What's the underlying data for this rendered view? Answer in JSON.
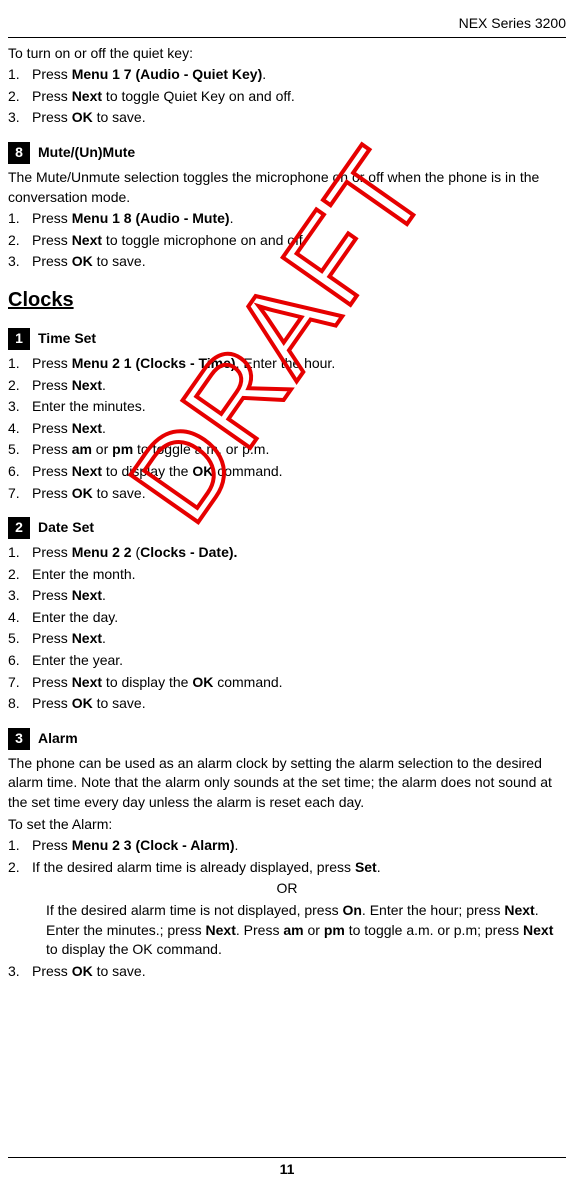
{
  "header": "NEX Series 3200",
  "intro": "To turn on or off the quiet key:",
  "quietKeyList": [
    {
      "n": "1.",
      "pre": "Press ",
      "b": "Menu 1 7 (Audio - Quiet Key)",
      "post": "."
    },
    {
      "n": "2.",
      "pre": "Press ",
      "b": "Next",
      "post": " to toggle Quiet Key on and off."
    },
    {
      "n": "3.",
      "pre": "Press ",
      "b": "OK",
      "post": " to save."
    }
  ],
  "sec8": {
    "num": "8",
    "title": "Mute/(Un)Mute"
  },
  "sec8Intro": "The Mute/Unmute selection toggles the microphone on or off when the phone is in the conversation mode.",
  "sec8List": [
    {
      "n": "1.",
      "pre": "Press ",
      "b": "Menu 1 8 (Audio - Mute)",
      "post": "."
    },
    {
      "n": "2.",
      "pre": "Press ",
      "b": "Next",
      "post": " to toggle microphone on and off."
    },
    {
      "n": "3.",
      "pre": "Press ",
      "b": "OK",
      "post": " to save."
    }
  ],
  "clocksTitle": "Clocks",
  "sec1": {
    "num": "1",
    "title": "Time Set"
  },
  "sec1List": [
    {
      "n": "1.",
      "pre": "Press ",
      "b": "Menu 2 1 (Clocks - Time)",
      "post": ". Enter the hour."
    },
    {
      "n": "2.",
      "pre": "Press ",
      "b": "Next",
      "post": "."
    },
    {
      "n": "3.",
      "pre": "Enter the minutes.",
      "b": "",
      "post": ""
    },
    {
      "n": "4.",
      "pre": "Press ",
      "b": "Next",
      "post": "."
    },
    {
      "n": "5.",
      "html": "Press <b>am</b> or <b>pm</b> to toggle a.m. or p.m."
    },
    {
      "n": "6.",
      "html": "Press <b>Next</b> to display the <b>OK</b> command."
    },
    {
      "n": "7.",
      "pre": "Press ",
      "b": "OK",
      "post": " to save."
    }
  ],
  "sec2": {
    "num": "2",
    "title": "Date Set"
  },
  "sec2List": [
    {
      "n": "1.",
      "html": "Press <b>Menu 2 2</b> (<b>Clocks - Date).</b>"
    },
    {
      "n": "2.",
      "pre": "Enter the month.",
      "b": "",
      "post": ""
    },
    {
      "n": "3.",
      "pre": "Press ",
      "b": "Next",
      "post": "."
    },
    {
      "n": "4.",
      "pre": "Enter the day.",
      "b": "",
      "post": ""
    },
    {
      "n": "5.",
      "pre": "Press ",
      "b": "Next",
      "post": "."
    },
    {
      "n": "6.",
      "pre": "Enter the year.",
      "b": "",
      "post": ""
    },
    {
      "n": "7.",
      "html": "Press <b>Next</b> to display the <b>OK</b> command."
    },
    {
      "n": "8.",
      "pre": "Press ",
      "b": "OK",
      "post": " to save."
    }
  ],
  "sec3": {
    "num": "3",
    "title": "Alarm"
  },
  "sec3Intro": "The phone can be used as an alarm clock by setting the alarm selection to the desired alarm time. Note that the alarm only sounds at the set time; the alarm does not sound at the set time every day unless the alarm is reset each day.",
  "sec3Lead": "To set the Alarm:",
  "sec3Item1": {
    "n": "1.",
    "pre": "Press ",
    "b": "Menu 2 3 (Clock - Alarm)",
    "post": "."
  },
  "sec3Item2": {
    "n": "2.",
    "html": "If the desired alarm time is already displayed, press <b>Set</b>."
  },
  "sec3Or": "OR",
  "sec3Alt": "If the desired alarm time is not displayed, press <b>On</b>. Enter the hour; press <b>Next</b>. Enter the minutes.; press <b>Next</b>. Press <b>am</b> or <b>pm</b> to toggle a.m. or p.m; press <b>Next</b> to display the OK command.",
  "sec3Item3": {
    "n": "3.",
    "pre": "Press ",
    "b": "OK",
    "post": " to save."
  },
  "pageNum": "11",
  "watermarkText": "DRAFT"
}
